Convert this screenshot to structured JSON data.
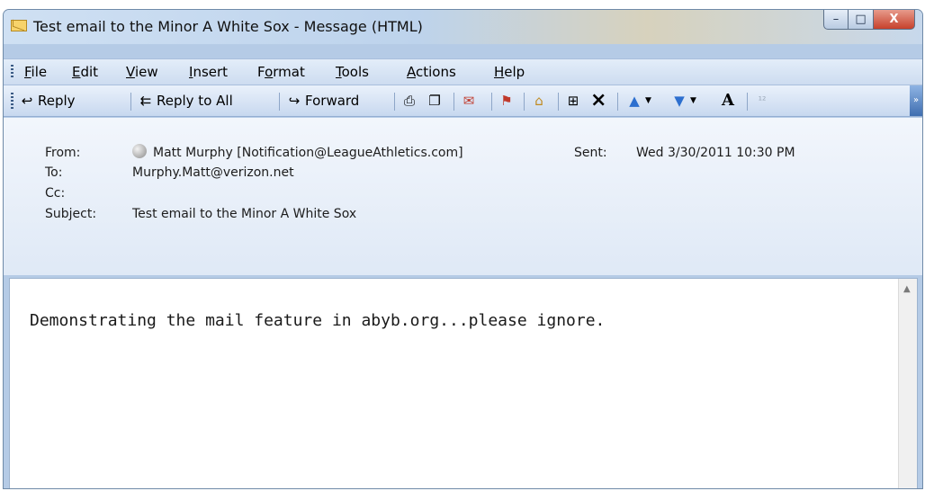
{
  "window": {
    "title": "Test email to the Minor A White Sox - Message (HTML)",
    "controls": {
      "minimize": "–",
      "maximize": "□",
      "close": "X"
    }
  },
  "menu": [
    {
      "label": "File",
      "key": "F",
      "rest": "ile"
    },
    {
      "label": "Edit",
      "key": "E",
      "rest": "dit"
    },
    {
      "label": "View",
      "key": "V",
      "rest": "iew"
    },
    {
      "label": "Insert",
      "key": "I",
      "rest": "nsert"
    },
    {
      "label": "Format",
      "pre": "F",
      "key": "o",
      "rest": "rmat"
    },
    {
      "label": "Tools",
      "key": "T",
      "rest": "ools"
    },
    {
      "label": "Actions",
      "key": "A",
      "rest": "ctions"
    },
    {
      "label": "Help",
      "key": "H",
      "rest": "elp"
    }
  ],
  "toolbar": {
    "reply": "Reply",
    "reply_all": "Reply to All",
    "forward": "Forward"
  },
  "header": {
    "from_label": "From:",
    "from_value": "Matt Murphy [Notification@LeagueAthletics.com]",
    "sent_label": "Sent:",
    "sent_value": "Wed 3/30/2011 10:30 PM",
    "to_label": "To:",
    "to_value": "Murphy.Matt@verizon.net",
    "cc_label": "Cc:",
    "cc_value": "",
    "subject_label": "Subject:",
    "subject_value": "Test email to the Minor A White Sox"
  },
  "body": {
    "text": "Demonstrating the mail feature in abyb.org...please ignore."
  },
  "colors": {
    "frame": "#6f8aa8",
    "toolbar": "#c7d8ef",
    "close_button": "#c7412c"
  }
}
